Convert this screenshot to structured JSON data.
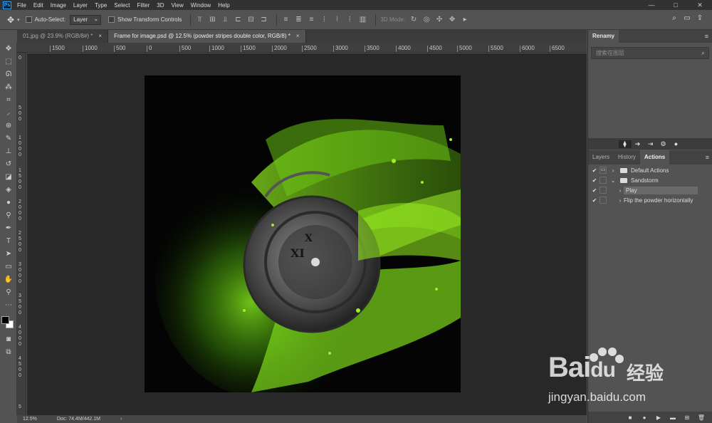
{
  "menubar": {
    "logo": "Ps",
    "items": [
      "File",
      "Edit",
      "Image",
      "Layer",
      "Type",
      "Select",
      "Filter",
      "3D",
      "View",
      "Window",
      "Help"
    ],
    "window_controls": [
      "—",
      "□",
      "✕"
    ]
  },
  "options": {
    "auto_select_label": "Auto-Select:",
    "layer_select": "Layer",
    "transform_label": "Show Transform Controls",
    "mode_3d": "3D Mode:"
  },
  "tabs": [
    {
      "label": "01.jpg @ 23.9% (RGB/8#) *",
      "close": "×"
    },
    {
      "label": "Frame for image.psd @ 12.5% (powder stripes double color, RGB/8) *",
      "close": "×"
    }
  ],
  "ruler": {
    "top_ticks": [
      "1500",
      "1000",
      "500",
      "0",
      "500",
      "1000",
      "1500",
      "2000",
      "2500",
      "3000",
      "3500",
      "4000",
      "4500",
      "5000",
      "5500",
      "6000",
      "6500"
    ],
    "left_ticks": [
      "0",
      "5 0 0",
      "1 0 0 0",
      "1 5 0 0",
      "2 0 0 0",
      "2 5 0 0",
      "3 0 0 0",
      "3 5 0 0",
      "4 0 0 0",
      "4 5 0 0",
      "5"
    ]
  },
  "status": {
    "zoom": "12.5%",
    "doc": "Doc: 74.4M/442.1M",
    "arrow": "›"
  },
  "panels": {
    "renamy": {
      "title": "Renamy",
      "search_placeholder": "搜索在图层"
    },
    "lower_tabs": [
      "Layers",
      "History",
      "Actions"
    ],
    "actions": [
      {
        "name": "Default Actions",
        "expander": "›",
        "has_dialog": true,
        "is_set": true
      },
      {
        "name": "Sandstorm",
        "expander": "⌄",
        "has_dialog": false,
        "is_set": true
      },
      {
        "name": "Play",
        "expander": "›",
        "has_dialog": false,
        "is_set": false
      },
      {
        "name": "Flip the powder horizontally",
        "expander": "›",
        "has_dialog": false,
        "is_set": false
      }
    ]
  },
  "watermark": {
    "brand": "Bai",
    "brand_suffix": "du",
    "cn": "经验",
    "url": "jingyan.baidu.com"
  }
}
